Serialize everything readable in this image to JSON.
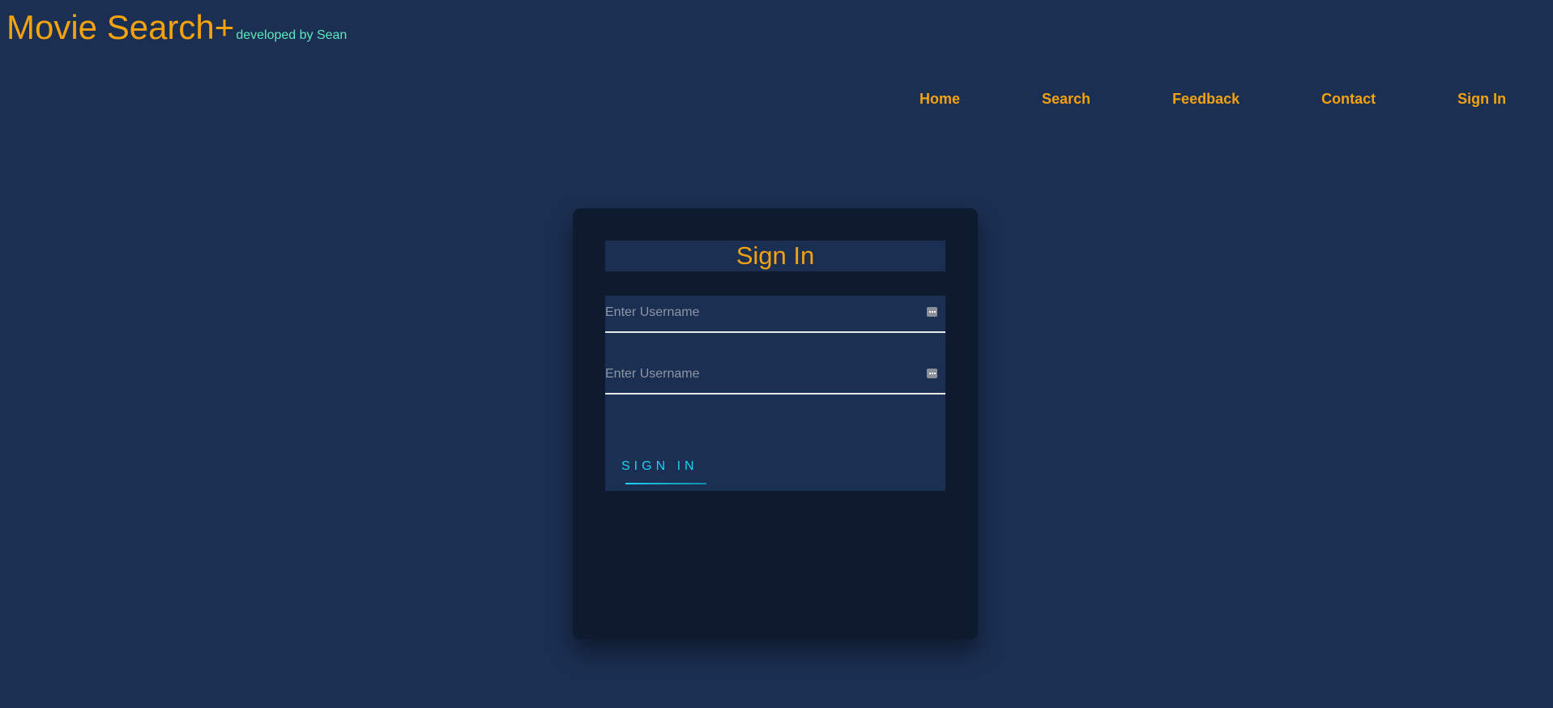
{
  "app": {
    "title": "Movie Search+",
    "subtitle": "developed by Sean"
  },
  "nav": {
    "items": [
      {
        "label": "Home"
      },
      {
        "label": "Search"
      },
      {
        "label": "Feedback"
      },
      {
        "label": "Contact"
      },
      {
        "label": "Sign In"
      }
    ]
  },
  "signin": {
    "title": "Sign In",
    "username": {
      "value": "",
      "placeholder": "Enter Username",
      "icon": "autofill-key-icon"
    },
    "password": {
      "value": "",
      "placeholder": "Enter Username",
      "icon": "autofill-key-icon"
    },
    "button_label": "SIGN IN"
  },
  "colors": {
    "background": "#1b2f52",
    "card": "#0e1a2d",
    "accent": "#f5a20f",
    "subtitle": "#5fe8bd",
    "button": "#1fd0f0"
  }
}
